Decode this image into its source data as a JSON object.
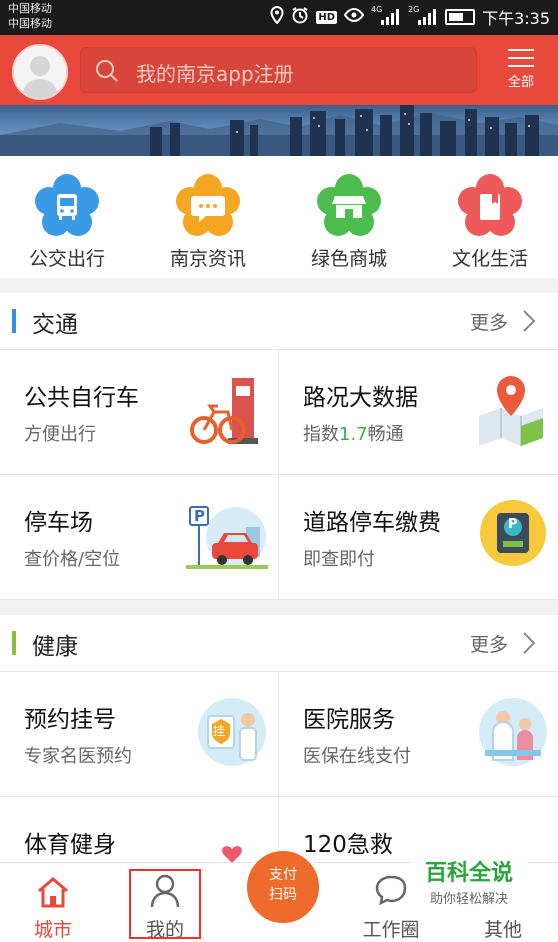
{
  "status": {
    "carrier1": "中国移动",
    "carrier2": "中国移动",
    "net1": "4G",
    "net2": "2G",
    "hd": "HD",
    "time": "下午3:35"
  },
  "header": {
    "search_placeholder": "我的南京app注册",
    "menu_label": "全部"
  },
  "quick": [
    {
      "label": "公交出行",
      "color": "#3b9ae6",
      "icon": "bus-icon"
    },
    {
      "label": "南京资讯",
      "color": "#f5a623",
      "icon": "chat-icon"
    },
    {
      "label": "绿色商城",
      "color": "#4cbc4f",
      "icon": "shop-icon"
    },
    {
      "label": "文化生活",
      "color": "#ee5a5a",
      "icon": "book-icon"
    }
  ],
  "traffic": {
    "title": "交通",
    "more": "更多",
    "accent": "#3b8fe0",
    "cards": [
      {
        "title": "公共自行车",
        "sub": "方便出行"
      },
      {
        "title": "路况大数据",
        "sub_pre": "指数",
        "sub_num": "1.7",
        "sub_post": "畅通"
      },
      {
        "title": "停车场",
        "sub": "查价格/空位"
      },
      {
        "title": "道路停车缴费",
        "sub": "即查即付"
      }
    ]
  },
  "health": {
    "title": "健康",
    "more": "更多",
    "accent": "#8bbf3b",
    "cards": [
      {
        "title": "预约挂号",
        "sub": "专家名医预约"
      },
      {
        "title": "医院服务",
        "sub": "医保在线支付"
      },
      {
        "title": "体育健身"
      },
      {
        "title": "120急救"
      }
    ]
  },
  "parking_sign": "P",
  "register_badge": "挂",
  "tabs": {
    "city": "城市",
    "mine": "我的",
    "pay_line1": "支付",
    "pay_line2": "扫码",
    "work": "工作圈",
    "other": "其他"
  },
  "watermark": {
    "title": "百科全说",
    "sub": "助你轻松解决"
  }
}
